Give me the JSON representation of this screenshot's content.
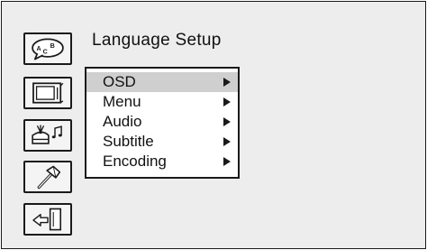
{
  "header": {
    "title": "Language Setup"
  },
  "sidebar": {
    "items": [
      {
        "icon": "language-abc-icon",
        "selected": true
      },
      {
        "icon": "tv-screen-icon",
        "selected": false
      },
      {
        "icon": "audio-speaker-icon",
        "selected": false
      },
      {
        "icon": "hammer-tools-icon",
        "selected": false
      },
      {
        "icon": "exit-door-icon",
        "selected": false
      }
    ]
  },
  "menu": {
    "items": [
      {
        "label": "OSD",
        "selected": true
      },
      {
        "label": "Menu",
        "selected": false
      },
      {
        "label": "Audio",
        "selected": false
      },
      {
        "label": "Subtitle",
        "selected": false
      },
      {
        "label": "Encoding",
        "selected": false
      }
    ]
  },
  "colors": {
    "background": "#ededed",
    "border": "#1a1a1a",
    "menu_background": "#ffffff",
    "highlight": "#cfcfcf"
  }
}
